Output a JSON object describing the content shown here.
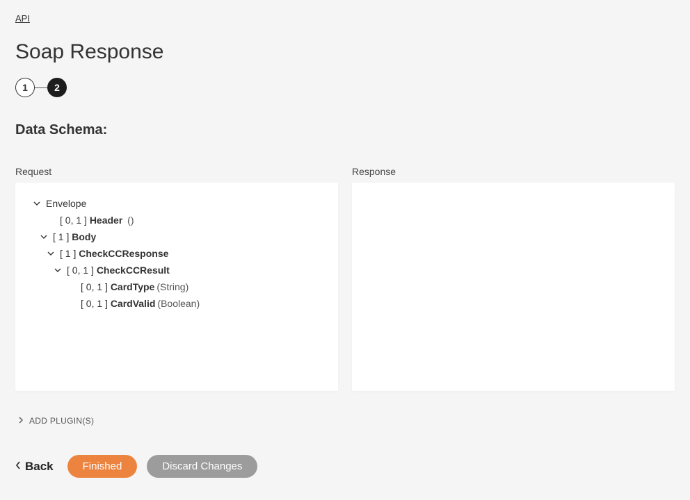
{
  "breadcrumb": {
    "api": "API"
  },
  "page_title": "Soap Response",
  "stepper": {
    "step1": "1",
    "step2": "2"
  },
  "section_title": "Data Schema:",
  "columns": {
    "request_label": "Request",
    "response_label": "Response"
  },
  "tree": {
    "envelope": {
      "label": "Envelope"
    },
    "header": {
      "cardinality": "[ 0, 1 ]",
      "name": "Header",
      "suffix": "()"
    },
    "body": {
      "cardinality": "[ 1 ]",
      "name": "Body"
    },
    "checkcc_response": {
      "cardinality": "[ 1 ]",
      "name": "CheckCCResponse"
    },
    "checkcc_result": {
      "cardinality": "[ 0, 1 ]",
      "name": "CheckCCResult"
    },
    "card_type": {
      "cardinality": "[ 0, 1 ]",
      "name": "CardType",
      "suffix": "(String)"
    },
    "card_valid": {
      "cardinality": "[ 0, 1 ]",
      "name": "CardValid",
      "suffix": "(Boolean)"
    }
  },
  "add_plugins_label": "ADD PLUGIN(S)",
  "footer": {
    "back": "Back",
    "finished": "Finished",
    "discard": "Discard Changes"
  }
}
